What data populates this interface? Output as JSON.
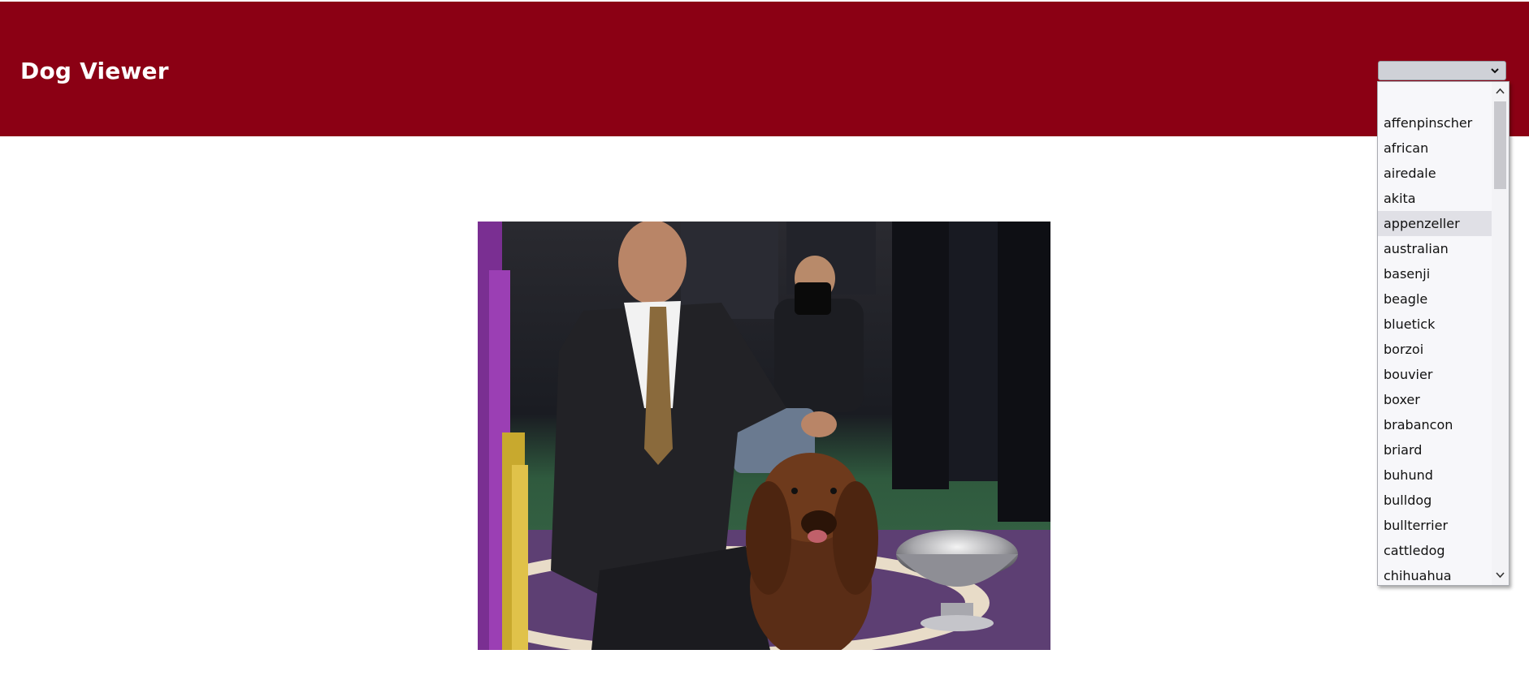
{
  "header": {
    "title": "Dog Viewer",
    "background_color": "#8b0014"
  },
  "breed_select": {
    "selected_value": "",
    "highlighted": "appenzeller",
    "options": [
      "",
      "affenpinscher",
      "african",
      "airedale",
      "akita",
      "appenzeller",
      "australian",
      "basenji",
      "beagle",
      "bluetick",
      "borzoi",
      "bouvier",
      "boxer",
      "brabancon",
      "briard",
      "buhund",
      "bulldog",
      "bullterrier",
      "cattledog",
      "chihuahua"
    ]
  },
  "main": {
    "image_icon": "dog-photo"
  }
}
